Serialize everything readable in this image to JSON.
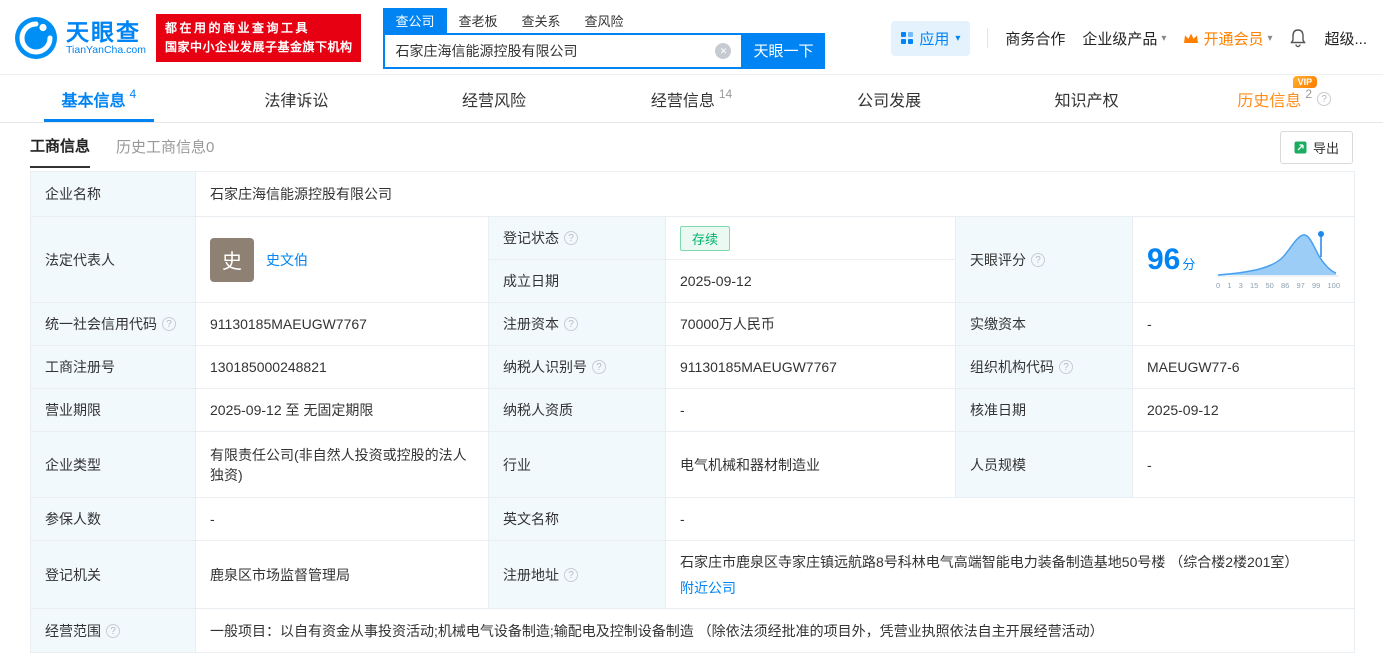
{
  "header": {
    "logo": {
      "brand": "天眼查",
      "domain": "TianYanCha.com"
    },
    "slogan": {
      "line1": "都在用的商业查询工具",
      "line2": "国家中小企业发展子基金旗下机构"
    },
    "search_tabs": {
      "company": "查公司",
      "boss": "查老板",
      "relation": "查关系",
      "risk": "查风险"
    },
    "search": {
      "value": "石家庄海信能源控股有限公司",
      "button": "天眼一下"
    },
    "menu": {
      "apps": "应用",
      "cooperation": "商务合作",
      "enterprise": "企业级产品",
      "vip": "开通会员",
      "super": "超级..."
    }
  },
  "nav": {
    "basic": {
      "label": "基本信息",
      "count": "4"
    },
    "legal": {
      "label": "法律诉讼"
    },
    "risk": {
      "label": "经营风险"
    },
    "business": {
      "label": "经营信息",
      "count": "14"
    },
    "development": {
      "label": "公司发展"
    },
    "ip": {
      "label": "知识产权"
    },
    "history": {
      "label": "历史信息",
      "count": "2",
      "vip": "VIP"
    }
  },
  "subtabs": {
    "current": "工商信息",
    "historical": "历史工商信息0",
    "export": "导出"
  },
  "info": {
    "company_name_label": "企业名称",
    "company_name": "石家庄海信能源控股有限公司",
    "legal_rep_label": "法定代表人",
    "legal_rep_avatar": "史",
    "legal_rep_name": "史文伯",
    "reg_status_label": "登记状态",
    "reg_status": "存续",
    "est_date_label": "成立日期",
    "est_date": "2025-09-12",
    "score_label": "天眼评分",
    "score_value": "96",
    "score_unit": "分",
    "credit_code_label": "统一社会信用代码",
    "credit_code": "91130185MAEUGW7767",
    "reg_capital_label": "注册资本",
    "reg_capital": "70000万人民币",
    "paid_capital_label": "实缴资本",
    "paid_capital": "-",
    "reg_number_label": "工商注册号",
    "reg_number": "130185000248821",
    "taxpayer_id_label": "纳税人识别号",
    "taxpayer_id": "91130185MAEUGW7767",
    "org_code_label": "组织机构代码",
    "org_code": "MAEUGW77-6",
    "business_term_label": "营业期限",
    "business_term": "2025-09-12 至 无固定期限",
    "taxpayer_quality_label": "纳税人资质",
    "taxpayer_quality": "-",
    "approval_date_label": "核准日期",
    "approval_date": "2025-09-12",
    "company_type_label": "企业类型",
    "company_type": "有限责任公司(非自然人投资或控股的法人独资)",
    "industry_label": "行业",
    "industry": "电气机械和器材制造业",
    "staff_size_label": "人员规模",
    "staff_size": "-",
    "insured_label": "参保人数",
    "insured": "-",
    "english_name_label": "英文名称",
    "english_name": "-",
    "reg_authority_label": "登记机关",
    "reg_authority": "鹿泉区市场监督管理局",
    "address_label": "注册地址",
    "address": "石家庄市鹿泉区寺家庄镇远航路8号科林电气高端智能电力装备制造基地50号楼 （综合楼2楼201室）",
    "nearby_link": "附近公司",
    "scope_label": "经营范围",
    "scope": "一般项目：以自有资金从事投资活动;机械电气设备制造;输配电及控制设备制造 （除依法须经批准的项目外，凭营业执照依法自主开展经营活动）"
  },
  "score_chart": {
    "type": "area",
    "ticks": [
      "0",
      "1",
      "3",
      "15",
      "50",
      "86",
      "97",
      "99",
      "100"
    ]
  },
  "icons": {
    "clear": "✕",
    "caret": "▾",
    "help": "?"
  },
  "colors": {
    "accent": "#0084f4",
    "brand_red": "#e60012",
    "vip_orange": "#ff8000",
    "status_green": "#00b26a"
  }
}
